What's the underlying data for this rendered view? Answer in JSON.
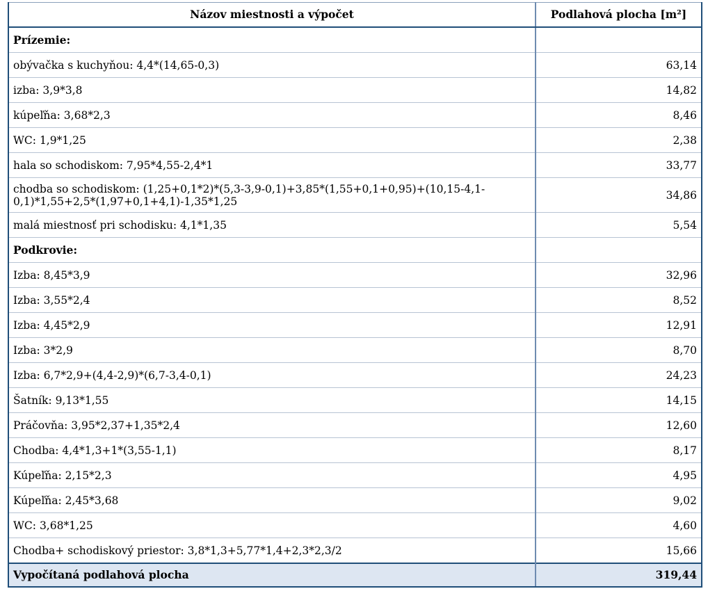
{
  "header": {
    "col1": "Názov miestnosti a výpočet",
    "col2": "Podlahová plocha [m²]"
  },
  "rows": [
    {
      "label": "Prízemie:",
      "value": "",
      "section": true
    },
    {
      "label": "obývačka s kuchyňou: 4,4*(14,65-0,3)",
      "value": "63,14"
    },
    {
      "label": "izba: 3,9*3,8",
      "value": "14,82"
    },
    {
      "label": "kúpeľňa: 3,68*2,3",
      "value": "8,46"
    },
    {
      "label": "WC: 1,9*1,25",
      "value": "2,38"
    },
    {
      "label": "hala so schodiskom: 7,95*4,55-2,4*1",
      "value": "33,77"
    },
    {
      "label": "chodba so schodiskom: (1,25+0,1*2)*(5,3-3,9-0,1)+3,85*(1,55+0,1+0,95)+(10,15-4,1-0,1)*1,55+2,5*(1,97+0,1+4,1)-1,35*1,25",
      "value": "34,86",
      "tall": true
    },
    {
      "label": "malá miestnosť pri schodisku: 4,1*1,35",
      "value": "5,54"
    },
    {
      "label": "Podkrovie:",
      "value": "",
      "section": true
    },
    {
      "label": "Izba: 8,45*3,9",
      "value": "32,96"
    },
    {
      "label": "Izba: 3,55*2,4",
      "value": "8,52"
    },
    {
      "label": "Izba: 4,45*2,9",
      "value": "12,91"
    },
    {
      "label": "Izba: 3*2,9",
      "value": "8,70"
    },
    {
      "label": "Izba: 6,7*2,9+(4,4-2,9)*(6,7-3,4-0,1)",
      "value": "24,23"
    },
    {
      "label": "Šatník: 9,13*1,55",
      "value": "14,15"
    },
    {
      "label": "Práčovňa: 3,95*2,37+1,35*2,4",
      "value": "12,60"
    },
    {
      "label": "Chodba: 4,4*1,3+1*(3,55-1,1)",
      "value": "8,17"
    },
    {
      "label": "Kúpeľňa: 2,15*2,3",
      "value": "4,95"
    },
    {
      "label": "Kúpeľňa: 2,45*3,68",
      "value": "9,02"
    },
    {
      "label": "WC: 3,68*1,25",
      "value": "4,60"
    },
    {
      "label": "Chodba+ schodiskový priestor: 3,8*1,3+5,77*1,4+2,3*2,3/2",
      "value": "15,66"
    }
  ],
  "total": {
    "label": "Vypočítaná podlahová plocha",
    "value": "319,44"
  }
}
